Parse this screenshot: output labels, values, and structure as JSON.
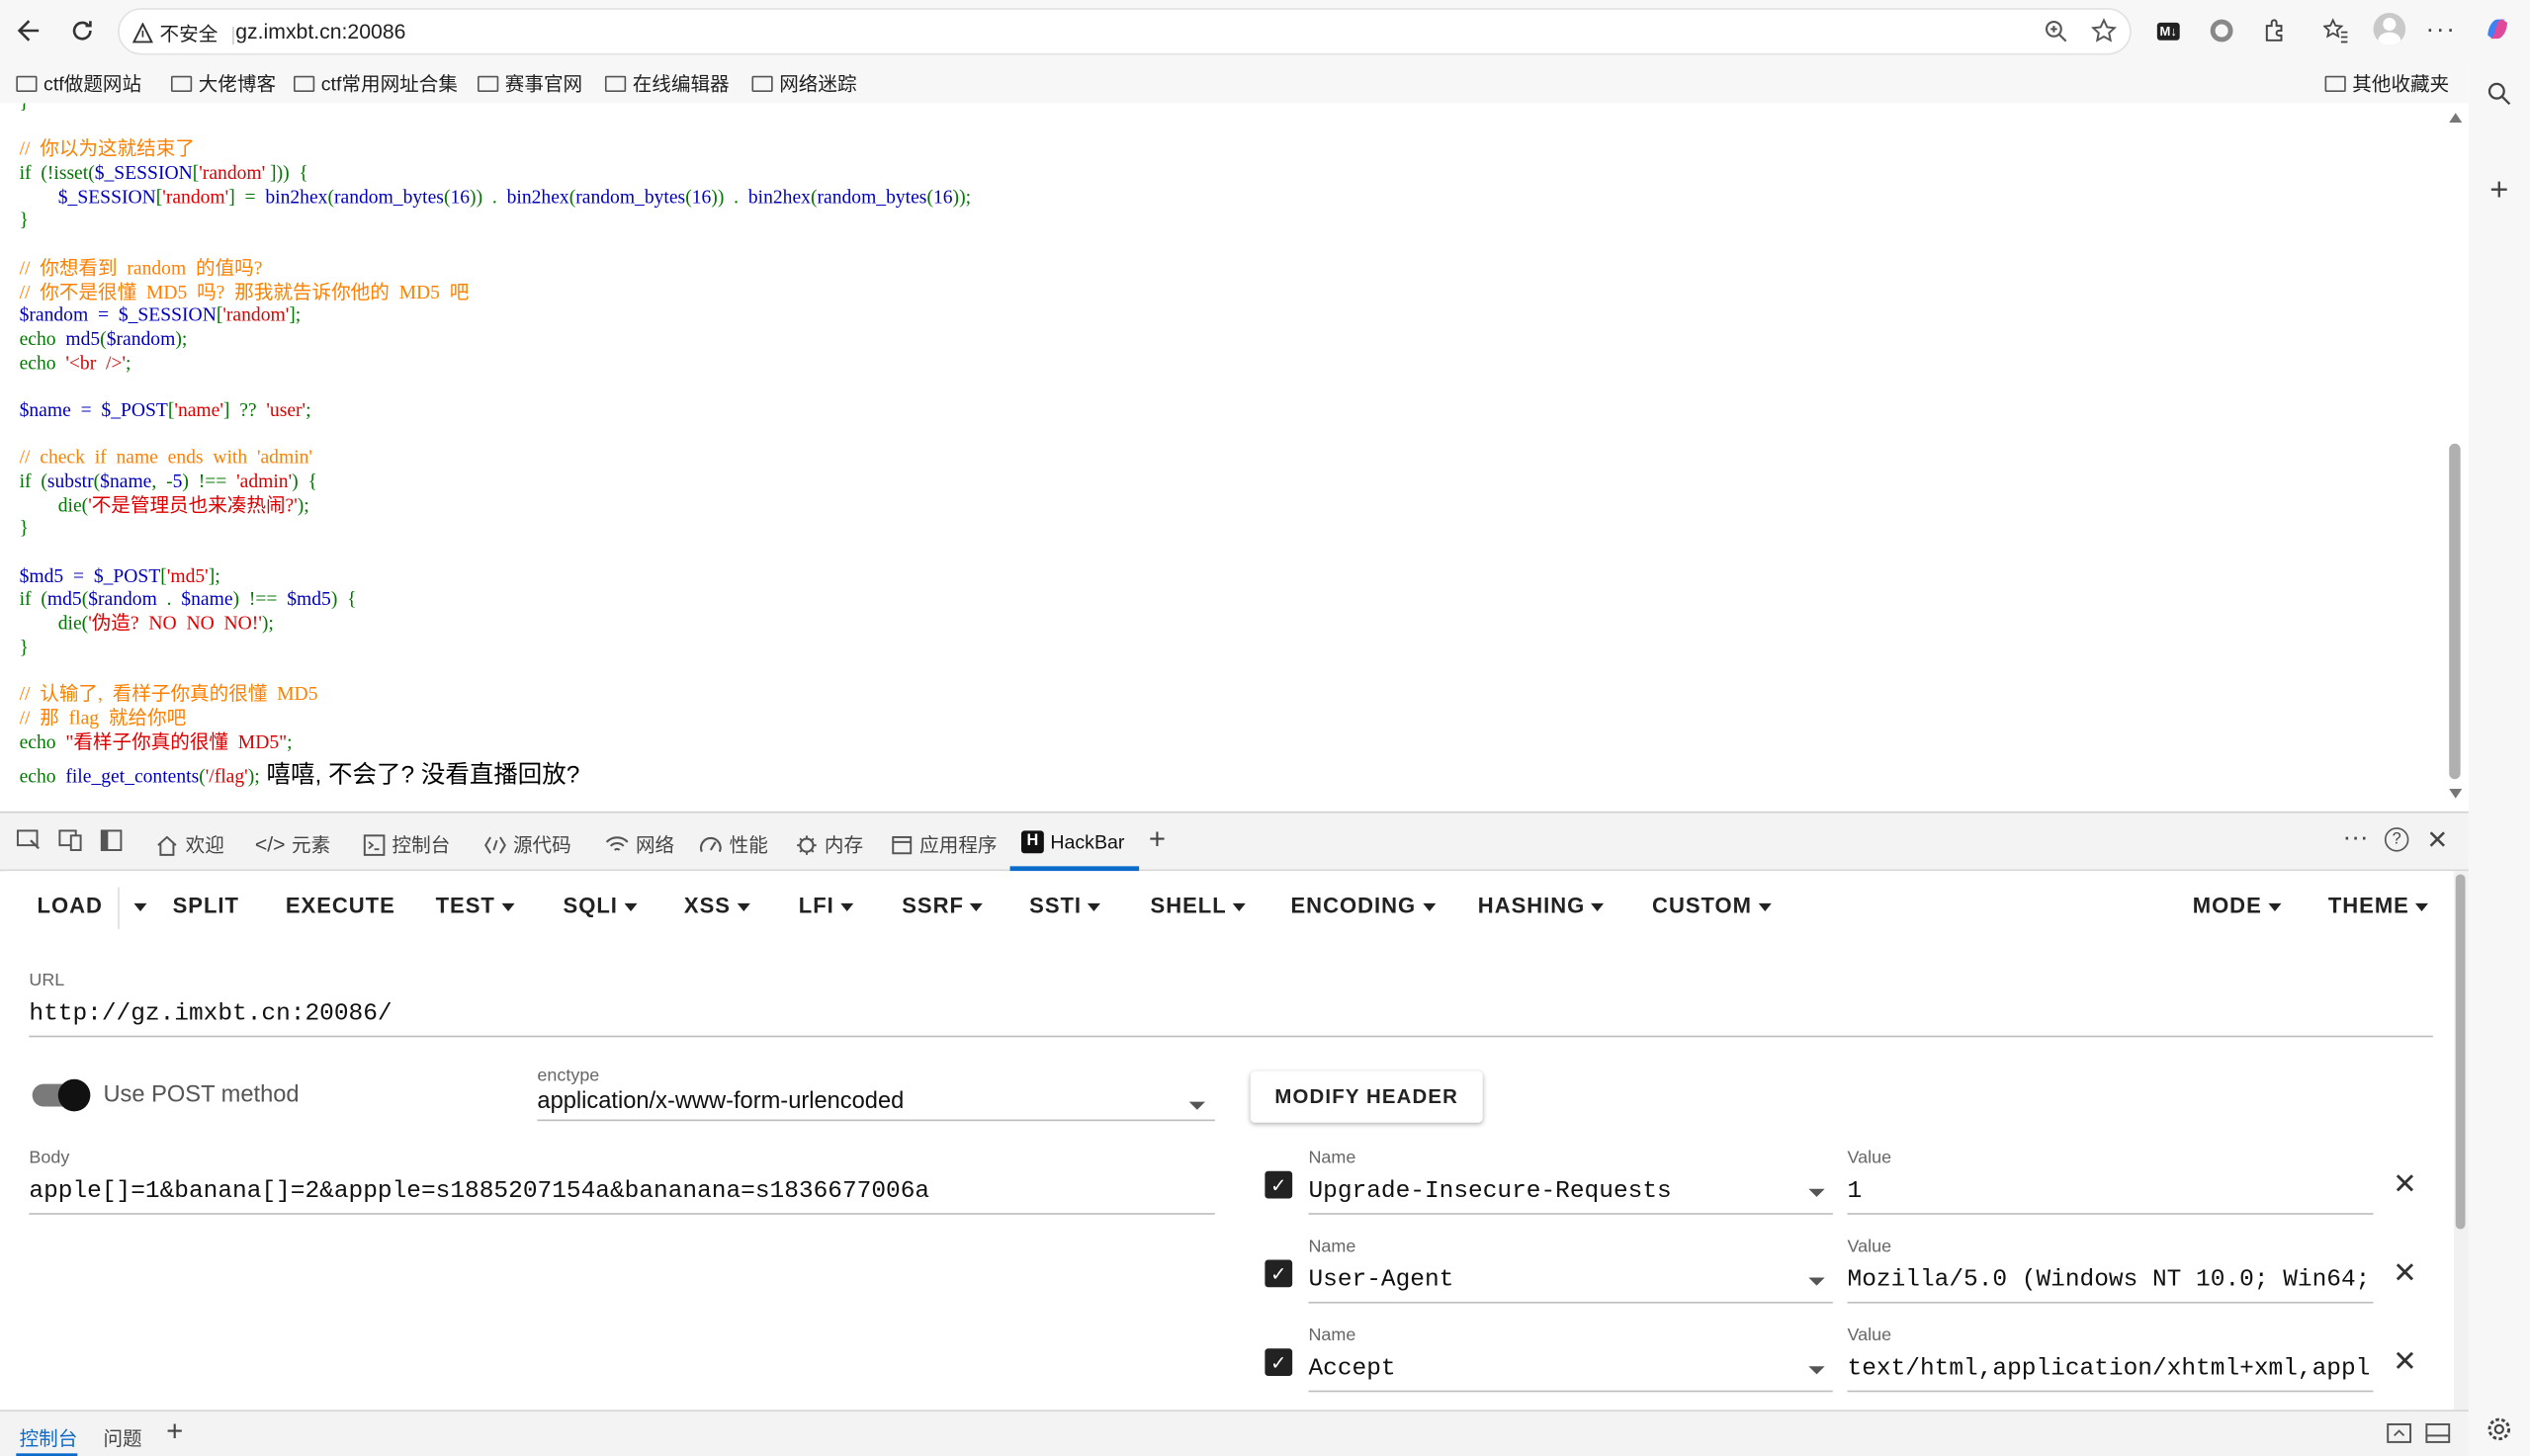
{
  "browser": {
    "security_label": "不安全",
    "url": "gz.imxbt.cn:20086",
    "bookmarks": [
      "ctf做题网站",
      "大佬博客",
      "ctf常用网址合集",
      "赛事官网",
      "在线编辑器",
      "网络迷踪"
    ],
    "other_bookmarks": "其他收藏夹"
  },
  "code": {
    "lines": [
      [
        [
          "}",
          "c-key"
        ]
      ],
      [],
      [
        [
          "//  你以为这就结束了",
          "c-com"
        ]
      ],
      [
        [
          "if  (!isset(",
          "c-key"
        ],
        [
          "$_SESSION",
          ""
        ],
        [
          "[",
          "c-key"
        ],
        [
          "'random'",
          "c-str"
        ],
        [
          " ]))  {",
          "c-key"
        ]
      ],
      [
        [
          "        $_SESSION",
          ""
        ],
        [
          "[",
          "c-key"
        ],
        [
          "'random'",
          "c-str"
        ],
        [
          "]  =  ",
          "c-key"
        ],
        [
          "bin2hex",
          ""
        ],
        [
          "(",
          "c-key"
        ],
        [
          "random_bytes",
          ""
        ],
        [
          "(",
          "c-key"
        ],
        [
          "16",
          ""
        ],
        [
          "))  .  ",
          "c-key"
        ],
        [
          "bin2hex",
          ""
        ],
        [
          "(",
          "c-key"
        ],
        [
          "random_bytes",
          ""
        ],
        [
          "(",
          "c-key"
        ],
        [
          "16",
          ""
        ],
        [
          "))  .  ",
          "c-key"
        ],
        [
          "bin2hex",
          ""
        ],
        [
          "(",
          "c-key"
        ],
        [
          "random_bytes",
          ""
        ],
        [
          "(",
          "c-key"
        ],
        [
          "16",
          ""
        ],
        [
          "));",
          "c-key"
        ]
      ],
      [
        [
          "}",
          "c-key"
        ]
      ],
      [],
      [
        [
          "//  你想看到  random  的值吗?",
          "c-com"
        ]
      ],
      [
        [
          "//  你不是很懂  MD5  吗?  那我就告诉你他的  MD5  吧",
          "c-com"
        ]
      ],
      [
        [
          "$random  =  $_SESSION",
          ""
        ],
        [
          "[",
          "c-key"
        ],
        [
          "'random'",
          "c-str"
        ],
        [
          "];",
          "c-key"
        ]
      ],
      [
        [
          "echo  ",
          "c-key"
        ],
        [
          "md5",
          ""
        ],
        [
          "(",
          "c-key"
        ],
        [
          "$random",
          ""
        ],
        [
          ");",
          "c-key"
        ]
      ],
      [
        [
          "echo  ",
          "c-key"
        ],
        [
          "'<br  />'",
          "c-str"
        ],
        [
          ";",
          "c-key"
        ]
      ],
      [],
      [
        [
          "$name  =  $_POST",
          ""
        ],
        [
          "[",
          "c-key"
        ],
        [
          "'name'",
          "c-str"
        ],
        [
          "]  ??  ",
          "c-key"
        ],
        [
          "'user'",
          "c-str"
        ],
        [
          ";",
          "c-key"
        ]
      ],
      [],
      [
        [
          "//  check  if  name  ends  with  'admin'",
          "c-com"
        ]
      ],
      [
        [
          "if  (",
          "c-key"
        ],
        [
          "substr",
          ""
        ],
        [
          "(",
          "c-key"
        ],
        [
          "$name",
          ""
        ],
        [
          ",  -",
          "c-key"
        ],
        [
          "5",
          ""
        ],
        [
          ")  !==  ",
          "c-key"
        ],
        [
          "'admin'",
          "c-str"
        ],
        [
          ")  {",
          "c-key"
        ]
      ],
      [
        [
          "        die(",
          "c-key"
        ],
        [
          "'不是管理员也来凑热闹?'",
          "c-str"
        ],
        [
          ");",
          "c-key"
        ]
      ],
      [
        [
          "}",
          "c-key"
        ]
      ],
      [],
      [
        [
          "$md5  =  $_POST",
          ""
        ],
        [
          "[",
          "c-key"
        ],
        [
          "'md5'",
          "c-str"
        ],
        [
          "];",
          "c-key"
        ]
      ],
      [
        [
          "if  (",
          "c-key"
        ],
        [
          "md5",
          ""
        ],
        [
          "(",
          "c-key"
        ],
        [
          "$random  ",
          ""
        ],
        [
          ".  ",
          "c-key"
        ],
        [
          "$name",
          ""
        ],
        [
          ")  !==  ",
          "c-key"
        ],
        [
          "$md5",
          ""
        ],
        [
          ")  {",
          "c-key"
        ]
      ],
      [
        [
          "        die(",
          "c-key"
        ],
        [
          "'伪造?  NO  NO  NO!'",
          "c-str"
        ],
        [
          ");",
          "c-key"
        ]
      ],
      [
        [
          "}",
          "c-key"
        ]
      ],
      [],
      [
        [
          "//  认输了,  看样子你真的很懂  MD5",
          "c-com"
        ]
      ],
      [
        [
          "//  那  flag  就给你吧",
          "c-com"
        ]
      ],
      [
        [
          "echo  ",
          "c-key"
        ],
        [
          "\"看样子你真的很懂  MD5\"",
          "c-str"
        ],
        [
          ";",
          "c-key"
        ]
      ]
    ],
    "last_line": [
      [
        "echo  ",
        "c-key"
      ],
      [
        "file_get_contents",
        ""
      ],
      [
        "(",
        "c-key"
      ],
      [
        "'/flag'",
        "c-str"
      ],
      [
        ");",
        "c-key"
      ]
    ],
    "result_text": "嘻嘻, 不会了? 没看直播回放?"
  },
  "devtools": {
    "tabs": [
      "欢迎",
      "元素",
      "控制台",
      "源代码",
      "网络",
      "性能",
      "内存",
      "应用程序",
      "HackBar"
    ],
    "active_tab": "HackBar",
    "drawer_tabs": [
      "控制台",
      "问题"
    ]
  },
  "hackbar": {
    "menus": [
      "LOAD",
      "SPLIT",
      "EXECUTE",
      "TEST",
      "SQLI",
      "XSS",
      "LFI",
      "SSRF",
      "SSTI",
      "SHELL",
      "ENCODING",
      "HASHING",
      "CUSTOM"
    ],
    "right_menus": [
      "MODE",
      "THEME"
    ],
    "url_label": "URL",
    "url_value": "http://gz.imxbt.cn:20086/",
    "post_label": "Use POST method",
    "enctype_label": "enctype",
    "enctype_value": "application/x-www-form-urlencoded",
    "modify_header": "MODIFY HEADER",
    "body_label": "Body",
    "body_value": "apple[]=1&banana[]=2&appple=s1885207154a&bananana=s1836677006a",
    "headers": [
      {
        "name_label": "Name",
        "name": "Upgrade-Insecure-Requests",
        "value_label": "Value",
        "value": "1"
      },
      {
        "name_label": "Name",
        "name": "User-Agent",
        "value_label": "Value",
        "value": "Mozilla/5.0 (Windows NT 10.0; Win64;"
      },
      {
        "name_label": "Name",
        "name": "Accept",
        "value_label": "Value",
        "value": "text/html,application/xhtml+xml,appl:"
      }
    ]
  }
}
